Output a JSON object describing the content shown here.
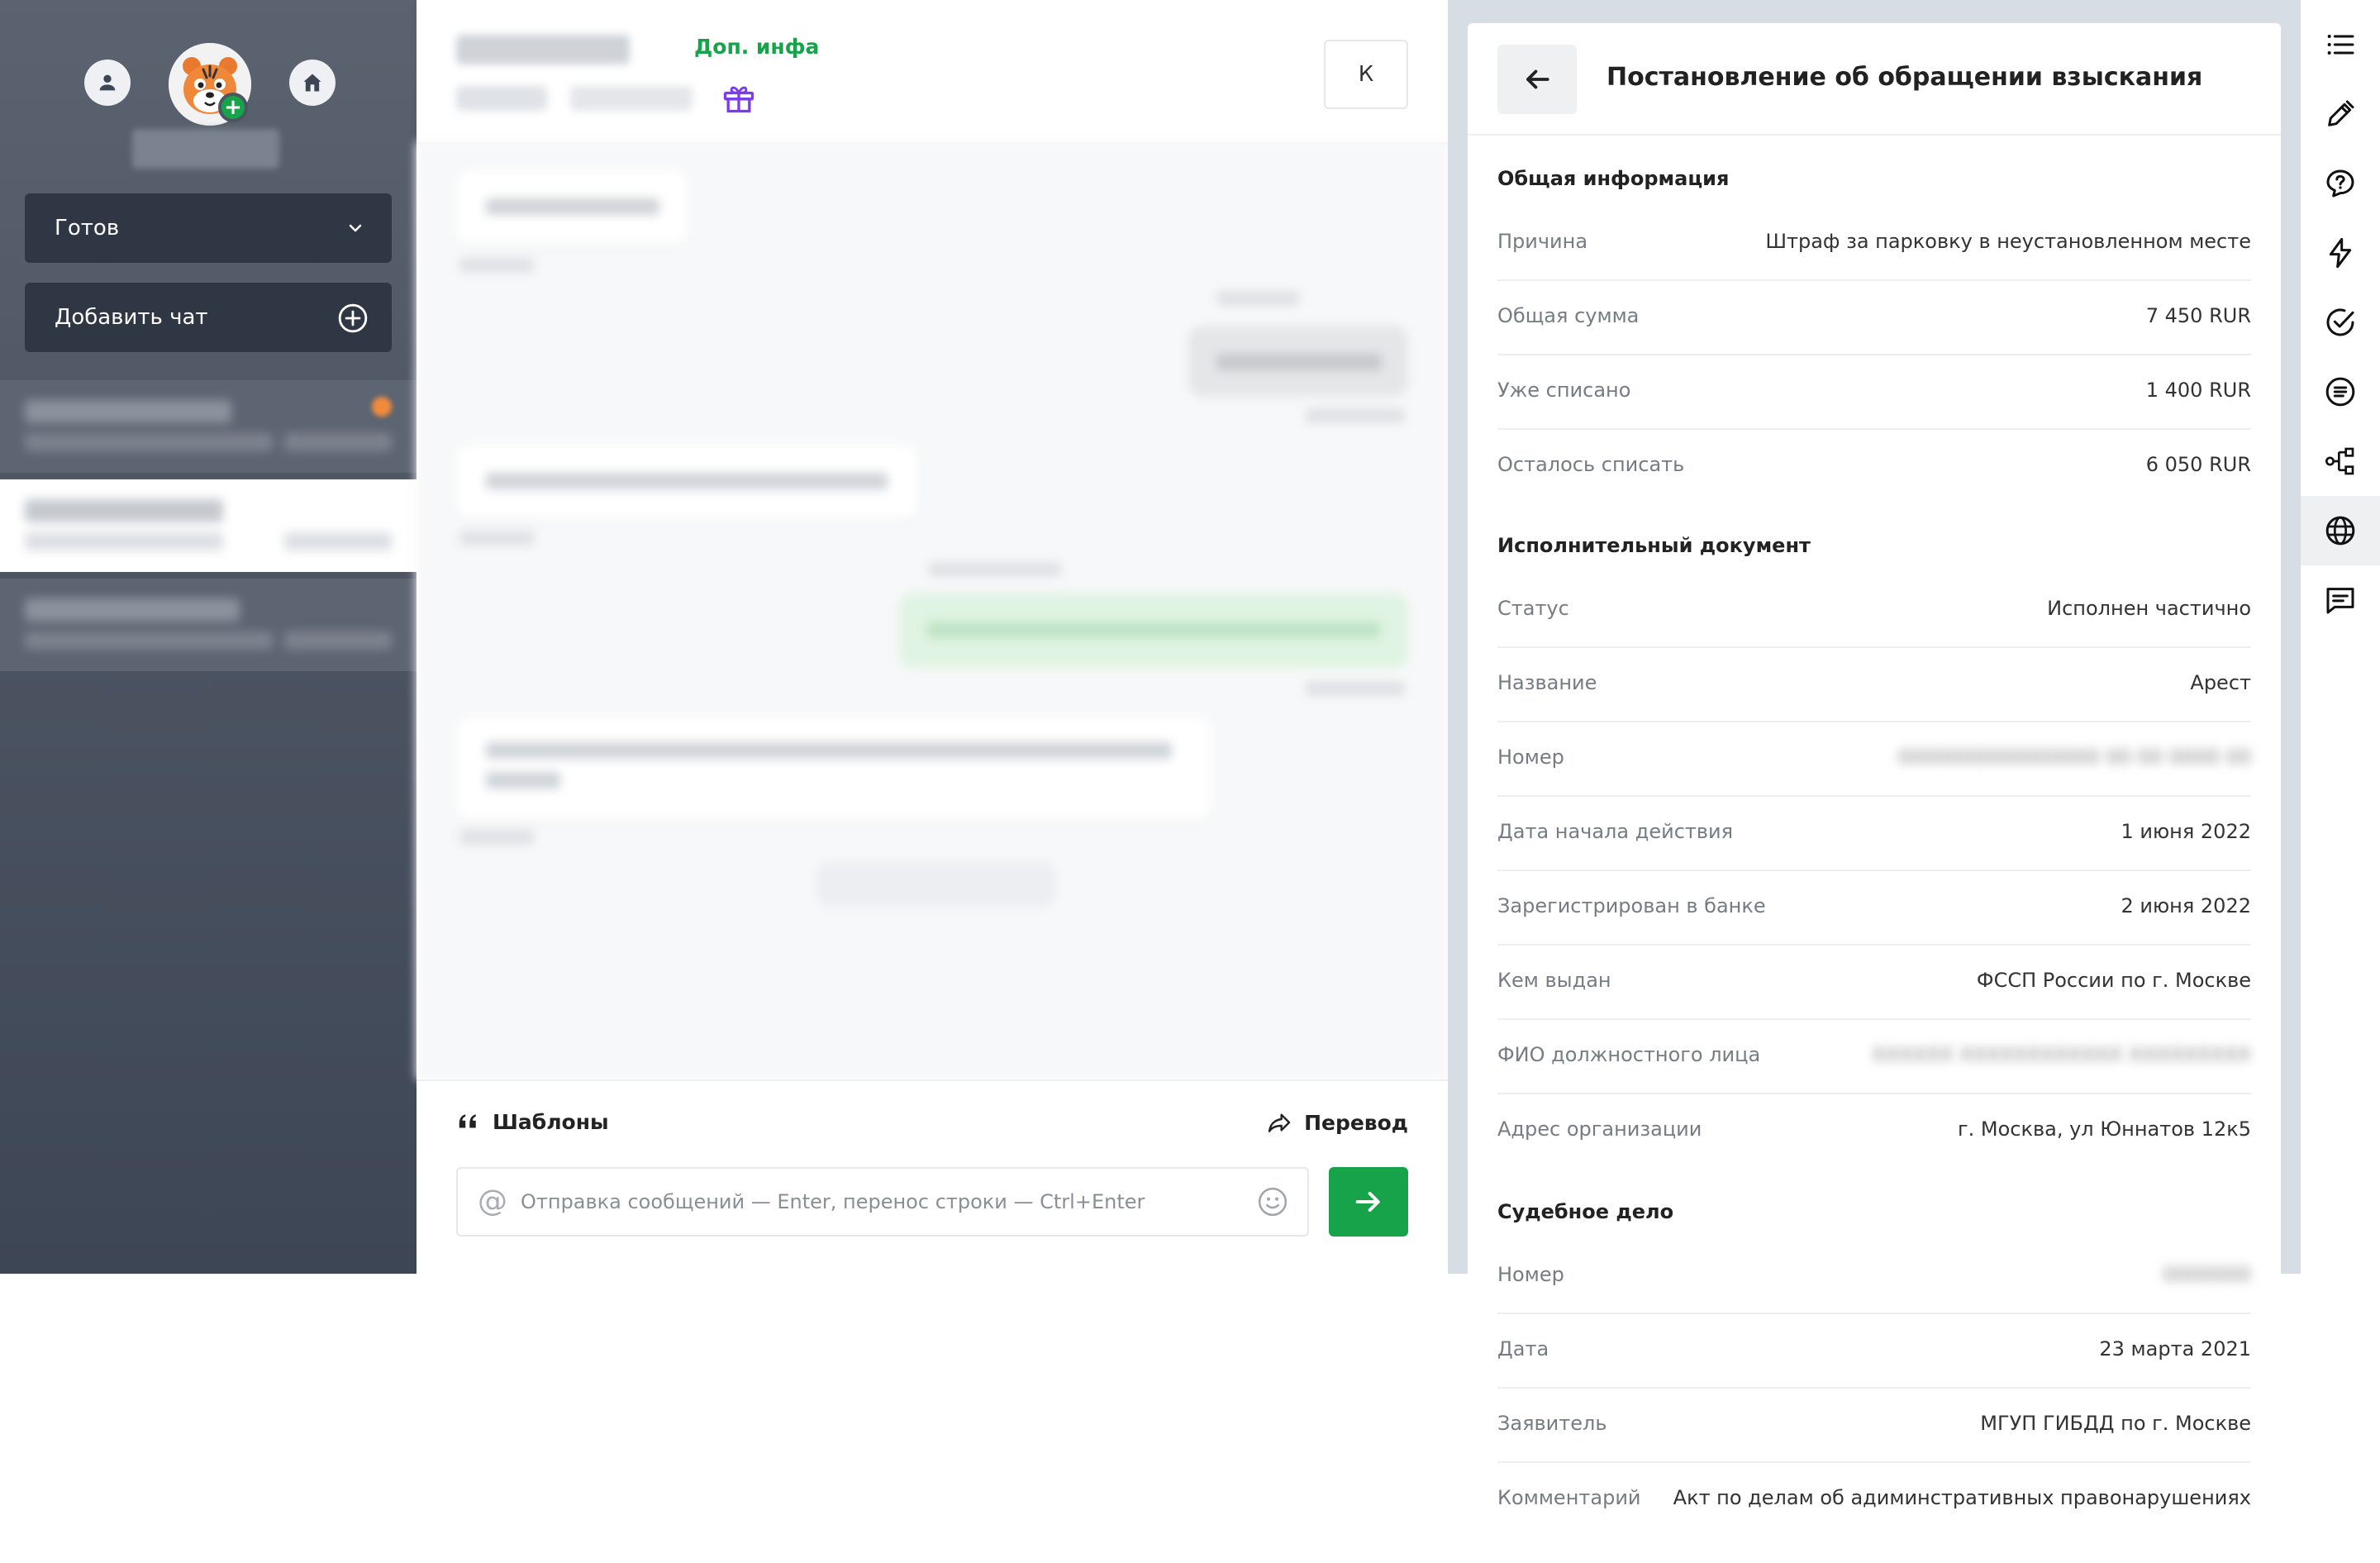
{
  "sidebar": {
    "status_select": "Готов",
    "add_chat_label": "Добавить чат"
  },
  "chat": {
    "header": {
      "extra_info_link": "Доп. инфа",
      "k_button": "К"
    },
    "composer": {
      "templates_label": "Шаблоны",
      "transfer_label": "Перевод",
      "input_placeholder": "Отправка сообщений — Enter, перенос строки — Ctrl+Enter"
    }
  },
  "detail": {
    "title": "Постановление об обращении взыскания",
    "sections": {
      "general": {
        "title": "Общая информация",
        "rows": [
          {
            "label": "Причина",
            "value": "Штраф за парковку в неустановленном месте"
          },
          {
            "label": "Общая сумма",
            "value": "7 450 RUR"
          },
          {
            "label": "Уже списано",
            "value": "1 400 RUR"
          },
          {
            "label": "Осталось списать",
            "value": "6 050 RUR"
          }
        ]
      },
      "execution": {
        "title": "Исполнительный документ",
        "rows": [
          {
            "label": "Статус",
            "value": "Исполнен частично"
          },
          {
            "label": "Название",
            "value": "Арест"
          },
          {
            "label": "Номер",
            "value": ""
          },
          {
            "label": "Дата начала действия",
            "value": "1 июня 2022"
          },
          {
            "label": "Зарегистрирован в банке",
            "value": "2 июня 2022"
          },
          {
            "label": "Кем выдан",
            "value": "ФССП России по г. Москве"
          },
          {
            "label": "ФИО должностного лица",
            "value": ""
          },
          {
            "label": "Адрес организации",
            "value": "г. Москва, ул Юннатов 12к5"
          }
        ]
      },
      "court": {
        "title": "Судебное дело",
        "rows": [
          {
            "label": "Номер",
            "value": ""
          },
          {
            "label": "Дата",
            "value": "23 марта 2021"
          },
          {
            "label": "Заявитель",
            "value": "МГУП ГИБДД по г. Москве"
          },
          {
            "label": "Комментарий",
            "value": "Акт по делам об адиминстративных правонарушениях"
          }
        ]
      }
    }
  },
  "colors": {
    "accent_green": "#16a34a",
    "sidebar_dark": "#2f3744",
    "gift_purple": "#7c3aed"
  }
}
